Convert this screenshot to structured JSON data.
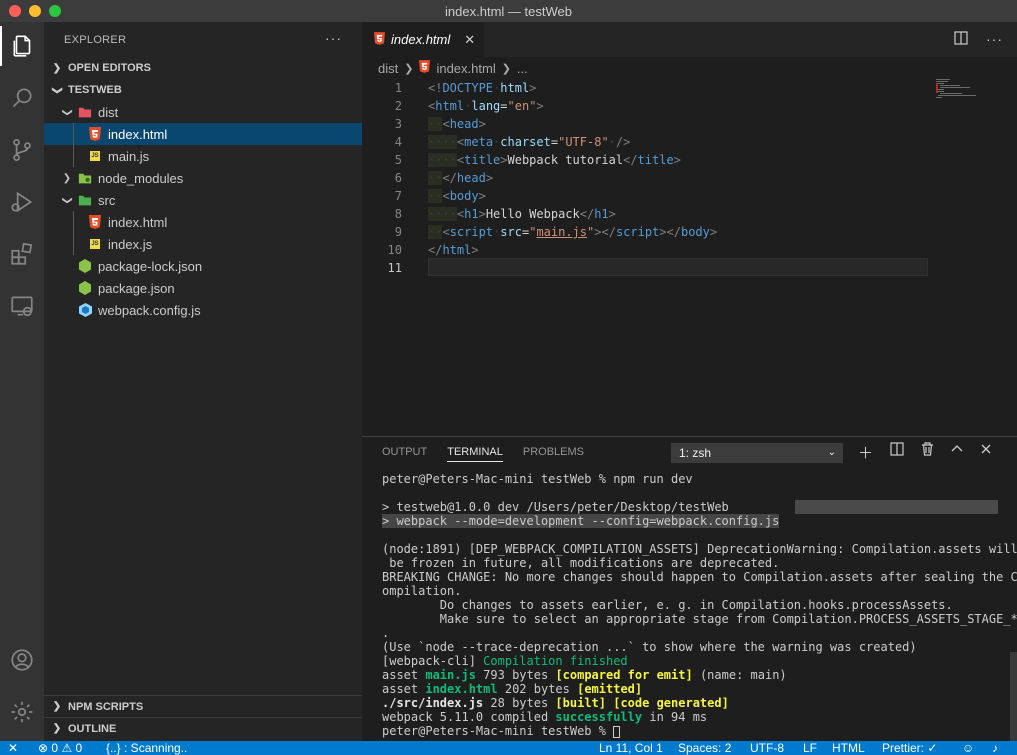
{
  "window": {
    "title": "index.html — testWeb"
  },
  "sidebar": {
    "header": "EXPLORER",
    "open_editors": "OPEN EDITORS",
    "project": "TESTWEB",
    "items": [
      {
        "label": "dist",
        "kind": "folder-open",
        "depth": 1
      },
      {
        "label": "index.html",
        "kind": "html",
        "depth": 2,
        "selected": true
      },
      {
        "label": "main.js",
        "kind": "js",
        "depth": 2
      },
      {
        "label": "node_modules",
        "kind": "folder-closed",
        "depth": 1
      },
      {
        "label": "src",
        "kind": "folder-open",
        "depth": 1
      },
      {
        "label": "index.html",
        "kind": "html",
        "depth": 2
      },
      {
        "label": "index.js",
        "kind": "js",
        "depth": 2
      },
      {
        "label": "package-lock.json",
        "kind": "json",
        "depth": 1
      },
      {
        "label": "package.json",
        "kind": "json",
        "depth": 1
      },
      {
        "label": "webpack.config.js",
        "kind": "webpack",
        "depth": 1
      }
    ],
    "npm_scripts": "NPM SCRIPTS",
    "outline": "OUTLINE"
  },
  "editor": {
    "tab_label": "index.html",
    "breadcrumb": {
      "folder": "dist",
      "file": "index.html",
      "more": "..."
    },
    "lines": [
      "1",
      "2",
      "3",
      "4",
      "5",
      "6",
      "7",
      "8",
      "9",
      "10",
      "11"
    ]
  },
  "panel": {
    "tabs": {
      "output": "OUTPUT",
      "terminal": "TERMINAL",
      "problems": "PROBLEMS"
    },
    "shell_select": "1: zsh",
    "terminal": {
      "l1": "peter@Peters-Mac-mini testWeb % npm run dev",
      "l2": "> testweb@1.0.0 dev /Users/peter/Desktop/testWeb",
      "l3": "> webpack --mode=development --config=webpack.config.js",
      "l4": "(node:1891) [DEP_WEBPACK_COMPILATION_ASSETS] DeprecationWarning: Compilation.assets will",
      "l5": " be frozen in future, all modifications are deprecated.",
      "l6": "BREAKING CHANGE: No more changes should happen to Compilation.assets after sealing the C",
      "l7": "ompilation.",
      "l8": "        Do changes to assets earlier, e. g. in Compilation.hooks.processAssets.",
      "l9": "        Make sure to select an appropriate stage from Compilation.PROCESS_ASSETS_STAGE_*",
      "l10": ".",
      "l11": "(Use `node --trace-deprecation ...` to show where the warning was created)",
      "wp_cli": "[webpack-cli]",
      "wp_done": "Compilation finished",
      "asset": "asset",
      "main_js": "main.js",
      "main_size": "793 bytes",
      "compared": "[compared for emit]",
      "main_name": "(name: main)",
      "index_html": "index.html",
      "index_size": "202 bytes",
      "emitted": "[emitted]",
      "src_index": "./src/index.js",
      "src_size": "28 bytes",
      "built": "[built]",
      "code_gen": "[code generated]",
      "wp_ver": "webpack 5.11.0 compiled",
      "success": "successfully",
      "time": "in 94 ms",
      "prompt": "peter@Peters-Mac-mini testWeb % "
    }
  },
  "statusbar": {
    "problems": "0",
    "warnings": "0",
    "scanning": "{..} : Scanning..",
    "position": "Ln 11, Col 1",
    "spaces": "Spaces: 2",
    "encoding": "UTF-8",
    "eol": "LF",
    "language": "HTML",
    "prettier": "Prettier: ✓"
  }
}
